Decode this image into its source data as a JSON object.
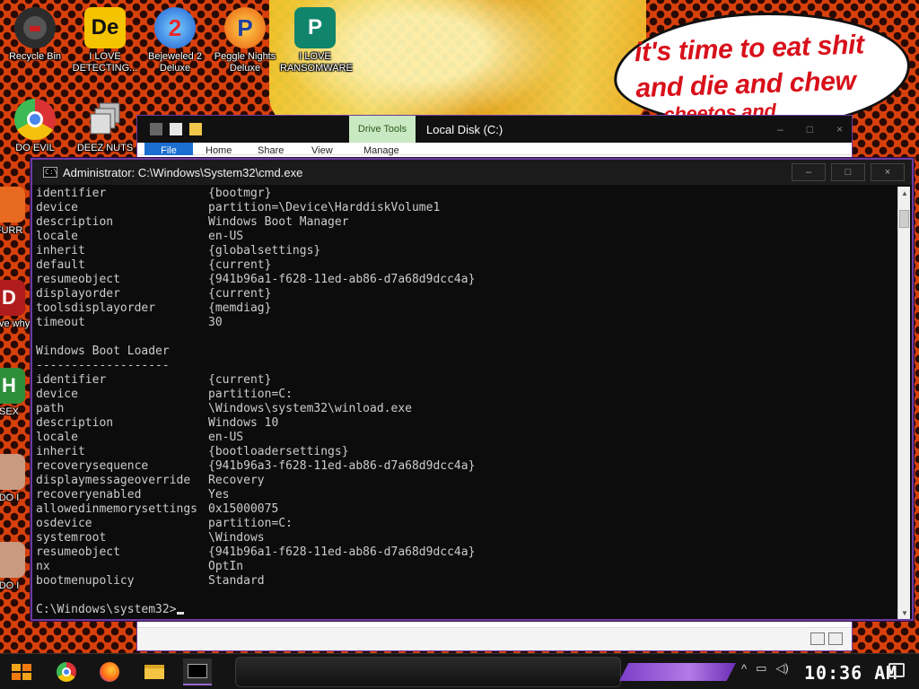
{
  "desktop": {
    "speech_bubble": {
      "line1": "it's time to eat shit",
      "line2": "and die and chew",
      "line3": "cheetos and"
    },
    "icons": [
      {
        "label": "Recycle Bin",
        "icon": "recycle-bin-icon"
      },
      {
        "label": "I LOVE DETECTING...",
        "icon": "de-icon"
      },
      {
        "label": "Bejeweled 2 Deluxe",
        "icon": "bejeweled-icon"
      },
      {
        "label": "Peggle Nights Deluxe",
        "icon": "peggle-icon"
      },
      {
        "label": "I LOVE RANSOMWARE",
        "icon": "publisher-icon"
      },
      {
        "label": "DO EVIL",
        "icon": "chrome-icon"
      },
      {
        "label": "DEEZ NUTS",
        "icon": "stack-icon"
      },
      {
        "label": "FURR",
        "icon": "fox-icon"
      },
      {
        "label": "neve why",
        "icon": "d-icon"
      },
      {
        "label": "SEX",
        "icon": "h-icon"
      },
      {
        "label": "DO I",
        "icon": "face-icon"
      },
      {
        "label": "DO I",
        "icon": "face-icon"
      }
    ]
  },
  "explorer": {
    "title": "Local Disk (C:)",
    "contextual_tab": "Drive Tools",
    "tabs": [
      "File",
      "Home",
      "Share",
      "View",
      "Manage"
    ]
  },
  "cmd": {
    "title": "Administrator: C:\\Windows\\System32\\cmd.exe",
    "controls": {
      "minimize": "–",
      "maximize": "□",
      "close": "×"
    },
    "boot_manager": [
      {
        "key": "identifier",
        "value": "{bootmgr}"
      },
      {
        "key": "device",
        "value": "partition=\\Device\\HarddiskVolume1"
      },
      {
        "key": "description",
        "value": "Windows Boot Manager"
      },
      {
        "key": "locale",
        "value": "en-US"
      },
      {
        "key": "inherit",
        "value": "{globalsettings}"
      },
      {
        "key": "default",
        "value": "{current}"
      },
      {
        "key": "resumeobject",
        "value": "{941b96a1-f628-11ed-ab86-d7a68d9dcc4a}"
      },
      {
        "key": "displayorder",
        "value": "{current}"
      },
      {
        "key": "toolsdisplayorder",
        "value": "{memdiag}"
      },
      {
        "key": "timeout",
        "value": "30"
      }
    ],
    "loader_heading": "Windows Boot Loader",
    "loader_separator": "-------------------",
    "boot_loader": [
      {
        "key": "identifier",
        "value": "{current}"
      },
      {
        "key": "device",
        "value": "partition=C:"
      },
      {
        "key": "path",
        "value": "\\Windows\\system32\\winload.exe"
      },
      {
        "key": "description",
        "value": "Windows 10"
      },
      {
        "key": "locale",
        "value": "en-US"
      },
      {
        "key": "inherit",
        "value": "{bootloadersettings}"
      },
      {
        "key": "recoverysequence",
        "value": "{941b96a3-f628-11ed-ab86-d7a68d9dcc4a}"
      },
      {
        "key": "displaymessageoverride",
        "value": "Recovery"
      },
      {
        "key": "recoveryenabled",
        "value": "Yes"
      },
      {
        "key": "allowedinmemorysettings",
        "value": "0x15000075"
      },
      {
        "key": "osdevice",
        "value": "partition=C:"
      },
      {
        "key": "systemroot",
        "value": "\\Windows"
      },
      {
        "key": "resumeobject",
        "value": "{941b96a1-f628-11ed-ab86-d7a68d9dcc4a}"
      },
      {
        "key": "nx",
        "value": "OptIn"
      },
      {
        "key": "bootmenupolicy",
        "value": "Standard"
      }
    ],
    "prompt": "C:\\Windows\\system32>"
  },
  "taskbar": {
    "apps": [
      "chrome-icon",
      "firefox-icon",
      "file-explorer-icon",
      "cmd-icon"
    ],
    "clock": "10:36 AM"
  },
  "colors": {
    "accent": "#6c3aa0",
    "desktop_bg": "#d8400c",
    "bubble_text": "#d8101a",
    "console_text": "#cccccc"
  }
}
